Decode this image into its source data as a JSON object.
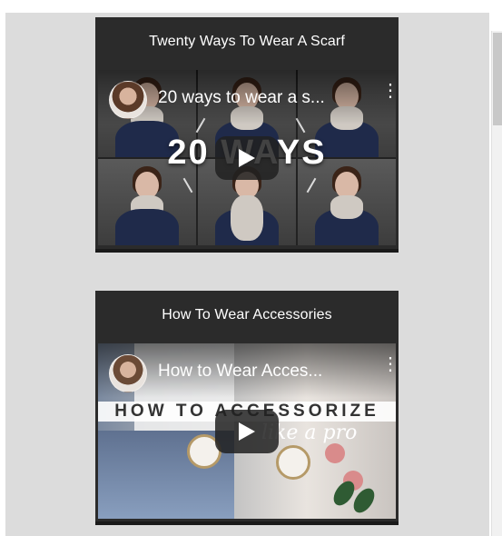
{
  "cards": [
    {
      "title": "Twenty Ways To Wear A Scarf",
      "video_title": "20 ways to wear a s...",
      "thumbnail_text": "20 WAYS"
    },
    {
      "title": "How To Wear Accessories",
      "video_title": "How to Wear Acces...",
      "thumbnail_text": "HOW TO ACCESSORIZE",
      "thumbnail_subtext": "like a pro"
    }
  ],
  "icons": {
    "play": "play-icon",
    "more": "more-vert-icon",
    "avatar": "channel-avatar"
  },
  "colors": {
    "card_bg": "#2b2b2b",
    "page_bg": "#dcdcdc",
    "play_button": "#212121"
  }
}
